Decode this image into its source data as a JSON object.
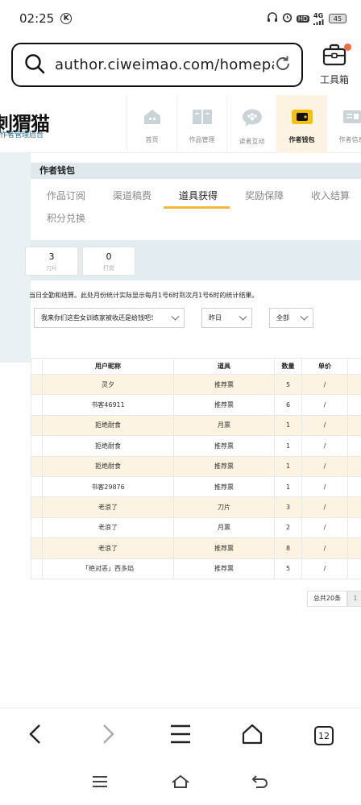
{
  "status_bar": {
    "time": "02:25",
    "k_badge": "K",
    "network": "4G",
    "battery": "45",
    "hd_badge": "HD"
  },
  "browser": {
    "url": "author.ciweimao.com/homepa•••",
    "toolbox_label": "工具箱",
    "tab_count": "12"
  },
  "site": {
    "logo_text": "刺猬猫",
    "logo_sub": "作者管理后台",
    "nav": [
      {
        "label": "首页",
        "icon": "home-icon"
      },
      {
        "label": "作品管理",
        "icon": "book-icon"
      },
      {
        "label": "读者互动",
        "icon": "chat-icon"
      },
      {
        "label": "作者钱包",
        "icon": "wallet-icon"
      },
      {
        "label": "作者信息",
        "icon": "info-icon"
      }
    ]
  },
  "panel": {
    "title": "作者钱包",
    "tabs": [
      "作品订阅",
      "渠道稿费",
      "道具获得",
      "奖励保障",
      "收入结算",
      "积分兑换"
    ],
    "active_tab": "道具获得"
  },
  "stats": [
    {
      "value": "3",
      "label": "刀片"
    },
    {
      "value": "0",
      "label": "打赏"
    }
  ],
  "notice": "当日全勤和结算。此处月份统计实际显示每月1号6时到次月1号6时的统计结果。",
  "filters": {
    "book": "我来你们这些女训练家被收还是给钱吧！",
    "date": "昨日",
    "type": "全部"
  },
  "table": {
    "headers": [
      "用户昵称",
      "道具",
      "数量",
      "单价"
    ],
    "rows": [
      [
        "灵夕",
        "推荐票",
        "5",
        "/"
      ],
      [
        "书客46911",
        "推荐票",
        "6",
        "/"
      ],
      [
        "拒绝耐食",
        "月票",
        "1",
        "/"
      ],
      [
        "拒绝耐食",
        "推荐票",
        "1",
        "/"
      ],
      [
        "拒绝耐食",
        "推荐票",
        "1",
        "/"
      ],
      [
        "书客29876",
        "推荐票",
        "1",
        "/"
      ],
      [
        "老浪了",
        "刀片",
        "3",
        "/"
      ],
      [
        "老浪了",
        "月票",
        "2",
        "/"
      ],
      [
        "老浪了",
        "推荐票",
        "8",
        "/"
      ],
      [
        "「绝对恶」西多焰",
        "推荐票",
        "5",
        "/"
      ]
    ]
  },
  "pagination": {
    "total": "总共20条",
    "page": "1"
  },
  "colors": {
    "accent": "#f2b73a",
    "active_bg": "#fdf3e3",
    "panel_bg": "#dfe8ec",
    "dot": "#f26b3a"
  }
}
